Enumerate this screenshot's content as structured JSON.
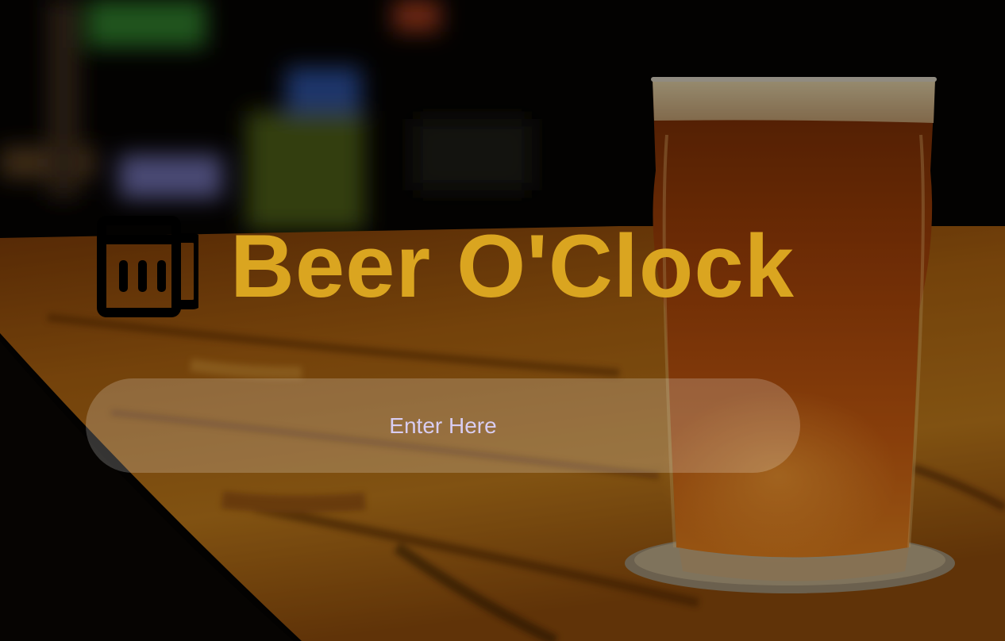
{
  "page": {
    "title": "Beer O'Clock",
    "logo_icon": "beer-mug-icon",
    "enter_label": "Enter Here"
  },
  "colors": {
    "title": "#daa520",
    "icon": "#000000",
    "button_text": "#d8cdf2",
    "overlay": "#000000"
  }
}
